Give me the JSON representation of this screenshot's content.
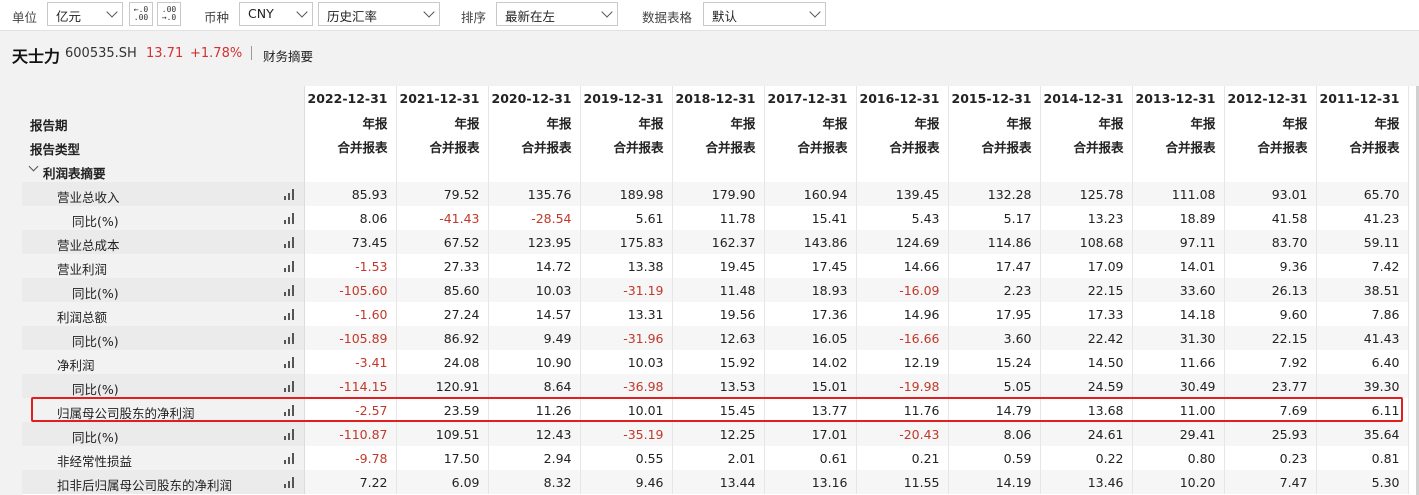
{
  "toolbar": {
    "unit_label": "单位",
    "unit_value": "亿元",
    "dec_increase": "+.0\n.00",
    "dec_decrease": ".00\n.0",
    "currency_label": "币种",
    "currency_value": "CNY",
    "rate_value": "历史汇率",
    "sort_label": "排序",
    "sort_value": "最新在左",
    "format_label": "数据表格",
    "format_value": "默认"
  },
  "stock": {
    "name": "天士力",
    "code": "600535.SH",
    "price": "13.71",
    "change": "+1.78%",
    "section": "财务摘要"
  },
  "table": {
    "header_rows": [
      {
        "label": "",
        "values": [
          "2022-12-31",
          "2021-12-31",
          "2020-12-31",
          "2019-12-31",
          "2018-12-31",
          "2017-12-31",
          "2016-12-31",
          "2015-12-31",
          "2014-12-31",
          "2013-12-31",
          "2012-12-31",
          "2011-12-31"
        ]
      },
      {
        "label": "报告期",
        "values": [
          "年报",
          "年报",
          "年报",
          "年报",
          "年报",
          "年报",
          "年报",
          "年报",
          "年报",
          "年报",
          "年报",
          "年报"
        ]
      },
      {
        "label": "报告类型",
        "values": [
          "合并报表",
          "合并报表",
          "合并报表",
          "合并报表",
          "合并报表",
          "合并报表",
          "合并报表",
          "合并报表",
          "合并报表",
          "合并报表",
          "合并报表",
          "合并报表"
        ]
      }
    ],
    "group_label": "利润表摘要",
    "rows": [
      {
        "label": "营业总收入",
        "indent": 1,
        "values": [
          "85.93",
          "79.52",
          "135.76",
          "189.98",
          "179.90",
          "160.94",
          "139.45",
          "132.28",
          "125.78",
          "111.08",
          "93.01",
          "65.70"
        ]
      },
      {
        "label": "同比(%)",
        "indent": 2,
        "values": [
          "8.06",
          "-41.43",
          "-28.54",
          "5.61",
          "11.78",
          "15.41",
          "5.43",
          "5.17",
          "13.23",
          "18.89",
          "41.58",
          "41.23"
        ]
      },
      {
        "label": "营业总成本",
        "indent": 1,
        "values": [
          "73.45",
          "67.52",
          "123.95",
          "175.83",
          "162.37",
          "143.86",
          "124.69",
          "114.86",
          "108.68",
          "97.11",
          "83.70",
          "59.11"
        ]
      },
      {
        "label": "营业利润",
        "indent": 1,
        "values": [
          "-1.53",
          "27.33",
          "14.72",
          "13.38",
          "19.45",
          "17.45",
          "14.66",
          "17.47",
          "17.09",
          "14.01",
          "9.36",
          "7.42"
        ]
      },
      {
        "label": "同比(%)",
        "indent": 2,
        "values": [
          "-105.60",
          "85.60",
          "10.03",
          "-31.19",
          "11.48",
          "18.93",
          "-16.09",
          "2.23",
          "22.15",
          "33.60",
          "26.13",
          "38.51"
        ]
      },
      {
        "label": "利润总额",
        "indent": 1,
        "values": [
          "-1.60",
          "27.24",
          "14.57",
          "13.31",
          "19.56",
          "17.36",
          "14.96",
          "17.95",
          "17.33",
          "14.18",
          "9.60",
          "7.86"
        ]
      },
      {
        "label": "同比(%)",
        "indent": 2,
        "values": [
          "-105.89",
          "86.92",
          "9.49",
          "-31.96",
          "12.63",
          "16.05",
          "-16.66",
          "3.60",
          "22.42",
          "31.30",
          "22.15",
          "41.43"
        ]
      },
      {
        "label": "净利润",
        "indent": 1,
        "values": [
          "-3.41",
          "24.08",
          "10.90",
          "10.03",
          "15.92",
          "14.02",
          "12.19",
          "15.24",
          "14.50",
          "11.66",
          "7.92",
          "6.40"
        ]
      },
      {
        "label": "同比(%)",
        "indent": 2,
        "values": [
          "-114.15",
          "120.91",
          "8.64",
          "-36.98",
          "13.53",
          "15.01",
          "-19.98",
          "5.05",
          "24.59",
          "30.49",
          "23.77",
          "39.30"
        ]
      },
      {
        "label": "归属母公司股东的净利润",
        "indent": 1,
        "values": [
          "-2.57",
          "23.59",
          "11.26",
          "10.01",
          "15.45",
          "13.77",
          "11.76",
          "14.79",
          "13.68",
          "11.00",
          "7.69",
          "6.11"
        ]
      },
      {
        "label": "同比(%)",
        "indent": 2,
        "values": [
          "-110.87",
          "109.51",
          "12.43",
          "-35.19",
          "12.25",
          "17.01",
          "-20.43",
          "8.06",
          "24.61",
          "29.41",
          "25.93",
          "35.64"
        ]
      },
      {
        "label": "非经常性损益",
        "indent": 1,
        "values": [
          "-9.78",
          "17.50",
          "2.94",
          "0.55",
          "2.01",
          "0.61",
          "0.21",
          "0.59",
          "0.22",
          "0.80",
          "0.23",
          "0.81"
        ]
      },
      {
        "label": "扣非后归属母公司股东的净利润",
        "indent": 1,
        "values": [
          "7.22",
          "6.09",
          "8.32",
          "9.46",
          "13.44",
          "13.16",
          "11.55",
          "14.19",
          "13.46",
          "10.20",
          "7.47",
          "5.30"
        ]
      }
    ]
  }
}
